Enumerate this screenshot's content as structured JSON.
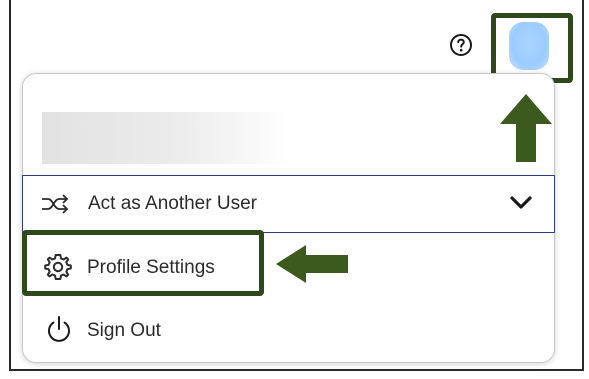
{
  "header": {
    "help_icon": "help-circle-icon",
    "avatar_icon": "user-avatar"
  },
  "menu": {
    "act_as_label": "Act as Another User",
    "act_as_icon": "shuffle-icon",
    "act_as_chevron": "chevron-down-icon",
    "profile_settings_label": "Profile Settings",
    "profile_settings_icon": "gear-icon",
    "sign_out_label": "Sign Out",
    "sign_out_icon": "power-icon"
  },
  "annotations": {
    "highlight_color": "#2e4a1c",
    "arrow_color": "#3d5a1e",
    "focus_border_color": "#2b3f8c"
  }
}
